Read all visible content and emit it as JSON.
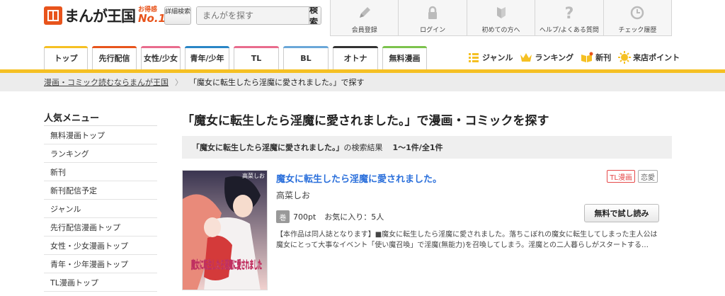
{
  "header": {
    "logo_mark": "まんが",
    "logo_text": "まんが王国",
    "logo_badge_top": "お得感",
    "logo_badge_no1": "No.1",
    "detail_search_label": "詳細検索",
    "search": {
      "placeholder": "まんがを探す",
      "button_label": "検索"
    },
    "top_nav": [
      {
        "label": "会員登録",
        "icon": "pencil-icon"
      },
      {
        "label": "ログイン",
        "icon": "lock-icon"
      },
      {
        "label": "初めての方へ",
        "icon": "beginner-mark-icon"
      },
      {
        "label": "ヘルプ/よくある質問",
        "icon": "question-icon"
      },
      {
        "label": "チェック履歴",
        "icon": "clock-icon"
      }
    ]
  },
  "tabs": [
    {
      "label": "トップ"
    },
    {
      "label": "先行配信"
    },
    {
      "label": "女性/少女"
    },
    {
      "label": "青年/少年"
    },
    {
      "label": "TL"
    },
    {
      "label": "BL"
    },
    {
      "label": "オトナ"
    },
    {
      "label": "無料漫画"
    }
  ],
  "quick_links": [
    {
      "label": "ジャンル",
      "icon": "list-icon"
    },
    {
      "label": "ランキング",
      "icon": "crown-icon"
    },
    {
      "label": "新刊",
      "icon": "new-book-icon"
    },
    {
      "label": "来店ポイント",
      "icon": "sun-icon"
    }
  ],
  "breadcrumb": {
    "home": "漫画・コミック読むならまんが王国",
    "separator": "〉",
    "current": "「魔女に転生したら淫魔に愛されました。」で探す"
  },
  "sidebar": {
    "title": "人気メニュー",
    "items": [
      "無料漫画トップ",
      "ランキング",
      "新刊",
      "新刊配信予定",
      "ジャンル",
      "先行配信漫画トップ",
      "女性・少女漫画トップ",
      "青年・少年漫画トップ",
      "TL漫画トップ"
    ]
  },
  "main": {
    "heading": "「魔女に転生したら淫魔に愛されました。」で漫画・コミックを探す",
    "result_query": "「魔女に転生したら淫魔に愛されました。」",
    "result_suffix": "の検索結果",
    "result_count": "1〜1件/全1件",
    "item": {
      "title": "魔女に転生したら淫魔に愛されました。",
      "author": "高菜しお",
      "tags": [
        "TL漫画",
        "恋愛"
      ],
      "volume_badge": "巻",
      "price": "700pt",
      "favorites": "お気に入り：5人",
      "trial_label": "無料で試し読み",
      "description": "【本作品は同人誌となります】■魔女に転生したら淫魔に愛されました。落ちこぼれの魔女に転生してしまった主人公は魔女にとって大事なイベント「使い魔召喚」で淫魔(無能力)を召喚してしまう。淫魔との二人暮らしがスタートする…",
      "cover_author": "高菜しお",
      "cover_title": "魔女に転生したら淫魔に愛されました"
    }
  },
  "colors": {
    "accent": "#f5c023",
    "brand": "#e8541c",
    "link": "#2a6fdb",
    "tag_red": "#e64a4a"
  }
}
